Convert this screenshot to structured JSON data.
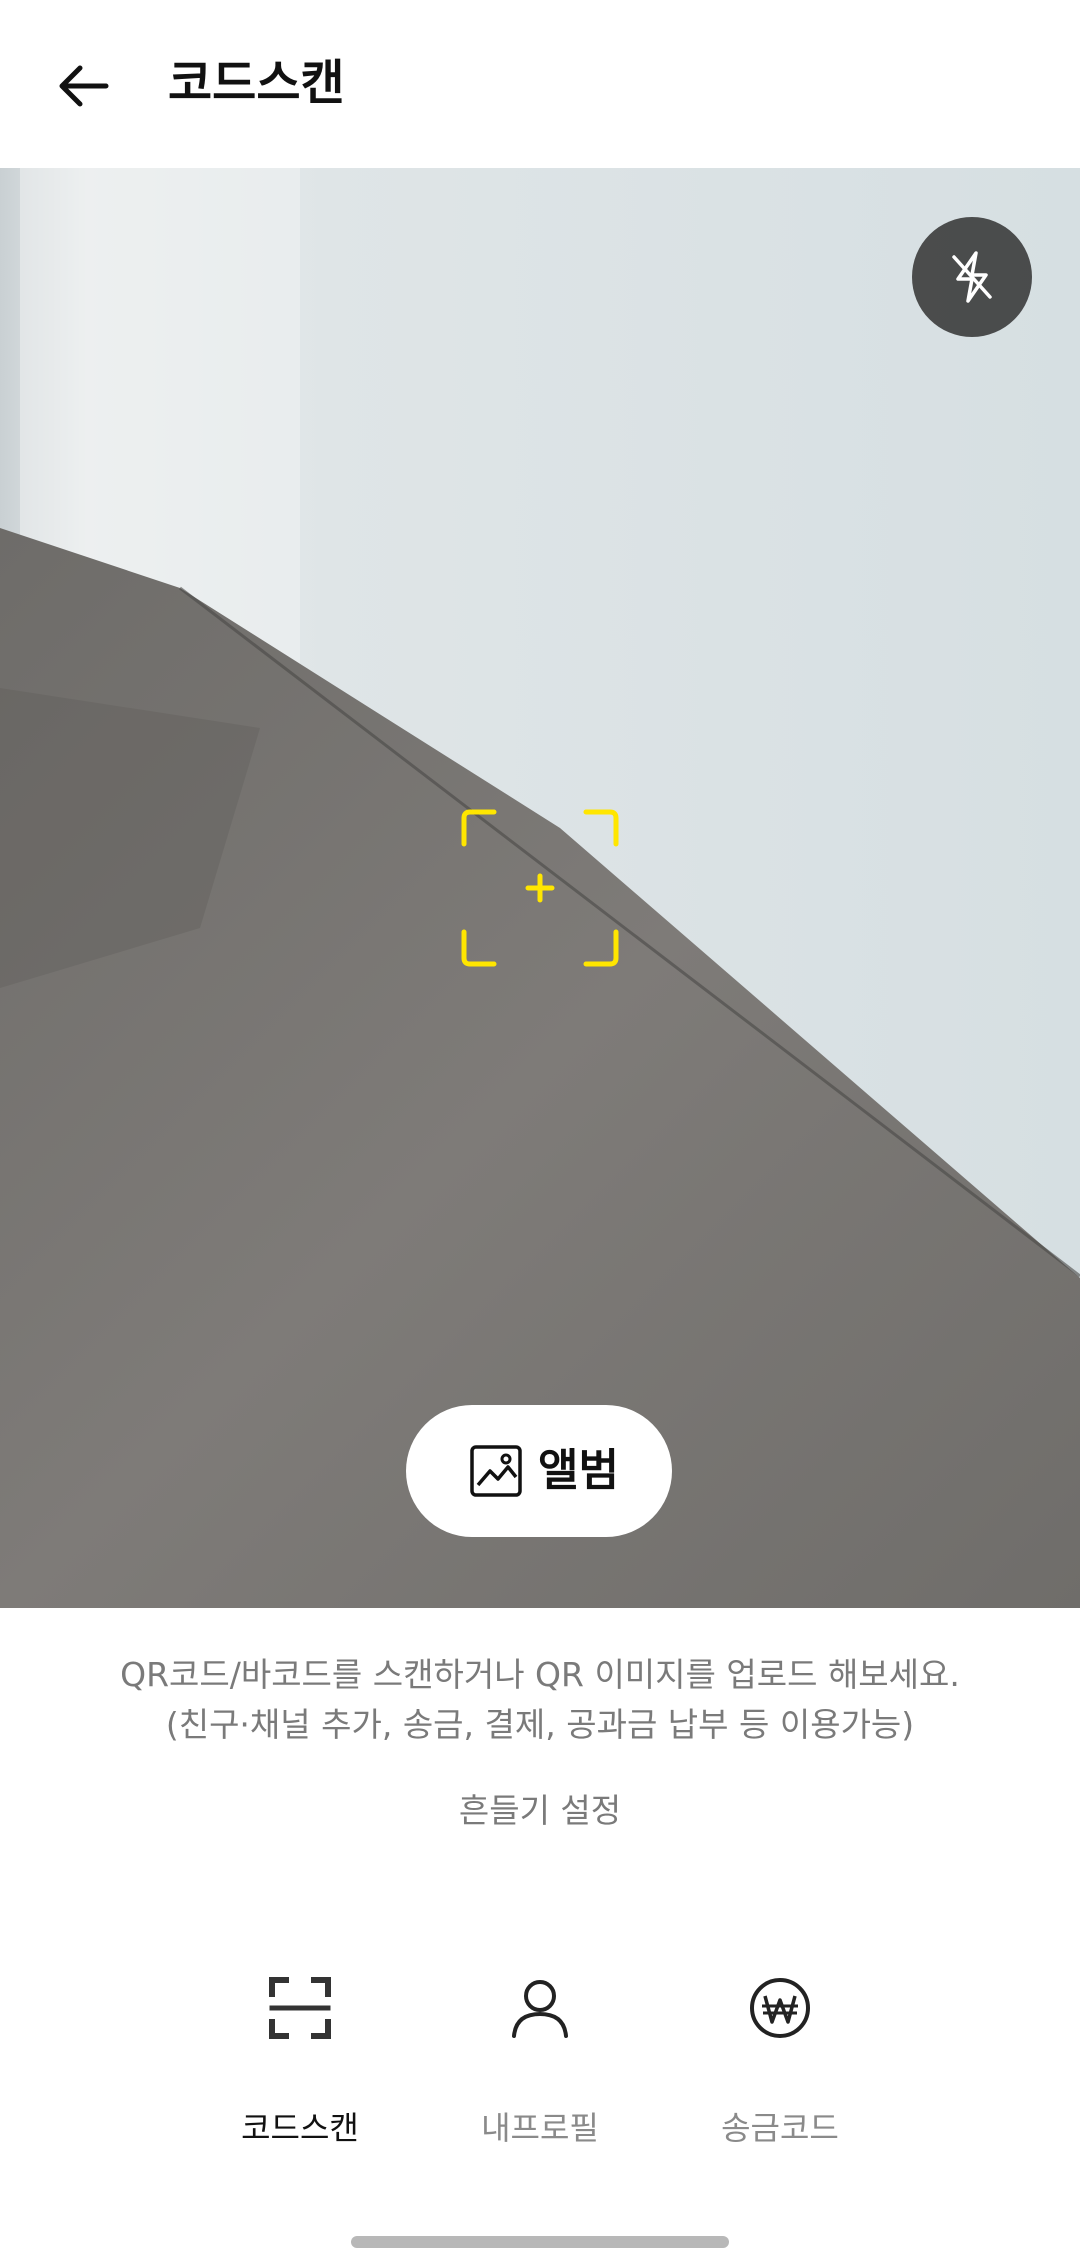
{
  "header": {
    "title": "코드스캔",
    "back_icon": "arrow-left-icon"
  },
  "camera": {
    "flash_icon": "flash-off-icon",
    "scan_frame_color": "#FFE600",
    "album_button": {
      "label": "앨범",
      "icon": "image-icon"
    }
  },
  "hint": {
    "line1": "QR코드/바코드를 스캔하거나 QR 이미지를 업로드 해보세요.",
    "line2": "(친구·채널 추가, 송금, 결제, 공과금 납부 등 이용가능)"
  },
  "shake_setting": "흔들기 설정",
  "tabs": [
    {
      "label": "코드스캔",
      "icon": "scan-icon",
      "active": true
    },
    {
      "label": "내프로필",
      "icon": "person-icon",
      "active": false
    },
    {
      "label": "송금코드",
      "icon": "won-icon",
      "active": false
    }
  ]
}
